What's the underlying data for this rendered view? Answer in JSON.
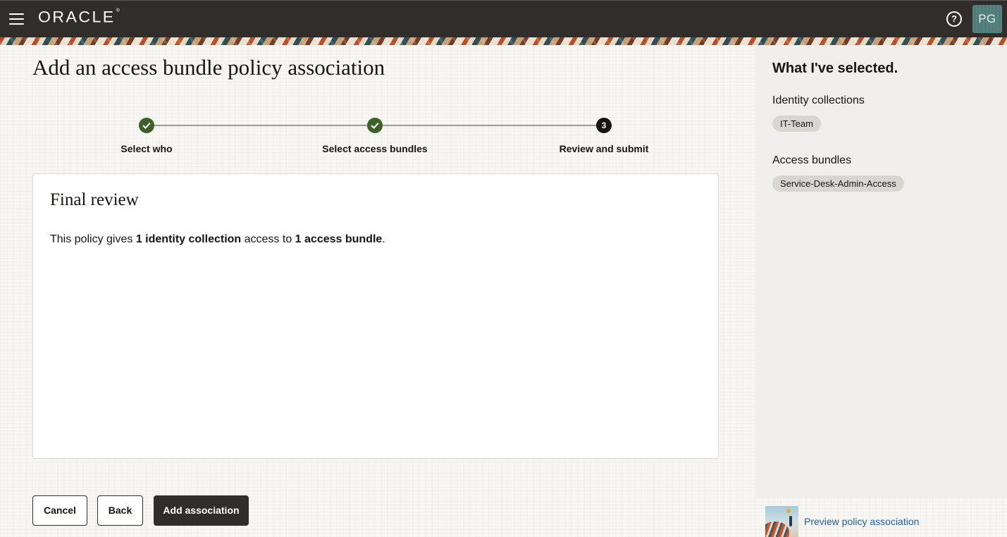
{
  "header": {
    "menu_icon": "hamburger-menu-icon",
    "logo_text": "ORACLE",
    "logo_mark": "®",
    "help_icon": "help-circle-icon",
    "help_glyph": "?",
    "avatar_initials": "PG",
    "colors": {
      "bar": "#312d2a",
      "avatar": "#4f7b78"
    }
  },
  "page": {
    "title": "Add an access bundle policy association"
  },
  "stepper": {
    "steps": [
      {
        "label": "Select who",
        "state": "complete",
        "icon": "check-icon"
      },
      {
        "label": "Select access bundles",
        "state": "complete",
        "icon": "check-icon"
      },
      {
        "label": "Review and submit",
        "state": "current",
        "number": "3"
      }
    ],
    "colors": {
      "complete": "#3f5f2a",
      "current": "#161513",
      "line": "#9e9a96"
    }
  },
  "review": {
    "title": "Final review",
    "text_1": "This policy gives ",
    "bold_1": "1 identity collection",
    "text_2": " access to ",
    "bold_2": "1 access bundle",
    "text_3": "."
  },
  "actions": {
    "cancel": "Cancel",
    "back": "Back",
    "submit": "Add association"
  },
  "sidebar": {
    "title": "What I've selected.",
    "identity_label": "Identity collections",
    "identity_items": [
      "IT-Team"
    ],
    "bundle_label": "Access bundles",
    "bundle_items": [
      "Service-Desk-Admin-Access"
    ],
    "preview_link": "Preview policy association",
    "preview_icon": "illustration-thumbnail"
  }
}
